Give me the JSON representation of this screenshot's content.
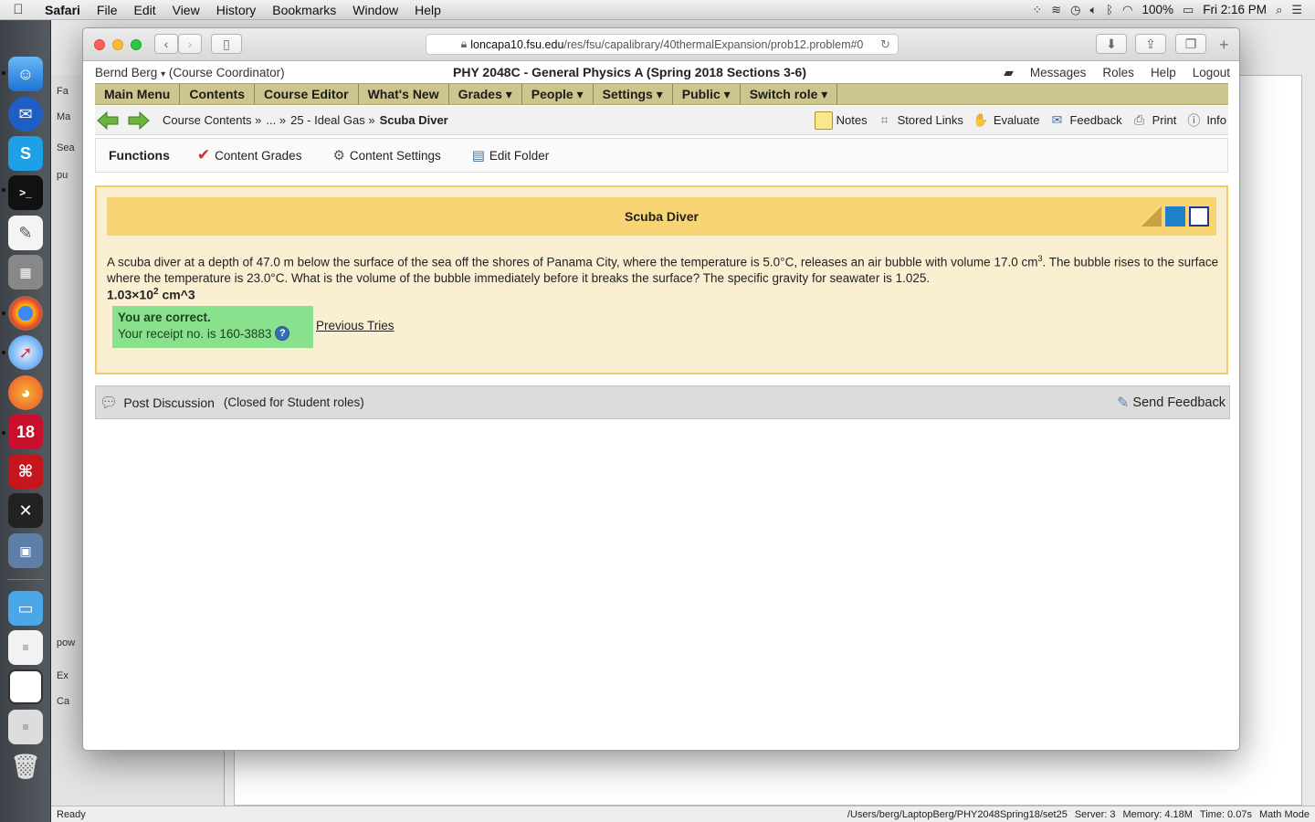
{
  "menubar": {
    "app": "Safari",
    "items": [
      "File",
      "Edit",
      "View",
      "History",
      "Bookmarks",
      "Window",
      "Help"
    ],
    "battery": "100%",
    "clock": "Fri 2:16 PM"
  },
  "dock": {
    "calendar_day": "18"
  },
  "browser": {
    "url_host": "loncapa10.fsu.edu",
    "url_path": "/res/fsu/capalibrary/40thermalExpansion/prob12.problem#0"
  },
  "lc": {
    "user": "Bernd Berg",
    "role": "(Course Coordinator)",
    "course": "PHY 2048C - General Physics A (Spring 2018 Sections 3-6)",
    "links": [
      "Messages",
      "Roles",
      "Help",
      "Logout"
    ],
    "nav": [
      "Main Menu",
      "Contents",
      "Course Editor",
      "What's New",
      "Grades ▾",
      "People ▾",
      "Settings ▾",
      "Public ▾",
      "Switch role ▾"
    ],
    "breadcrumb": [
      "Course Contents »",
      "... »",
      "25 - Ideal Gas »",
      "Scuba Diver"
    ],
    "tools": [
      "Notes",
      "Stored Links",
      "Evaluate",
      "Feedback",
      "Print",
      "Info"
    ],
    "functions_label": "Functions",
    "functions": [
      "Content Grades",
      "Content Settings",
      "Edit Folder"
    ]
  },
  "problem": {
    "title": "Scuba Diver",
    "text_1": "A scuba diver at a depth of 47.0 m below the surface of the sea off the shores of Panama City, where the temperature is 5.0°C, releases an air bubble with volume 17.0 cm",
    "text_sup": "3",
    "text_2": ". The bubble rises to the surface where the temperature is 23.0°C. What is the volume of the bubble immediately before it breaks the surface? The specific gravity for seawater is 1.025.",
    "answer_base": "1.03×10",
    "answer_exp": "2",
    "answer_unit": " cm^3",
    "status": "You are correct.",
    "receipt": "Your receipt no. is 160-3883",
    "previous_tries": "Previous Tries"
  },
  "discussion": {
    "post": "Post Discussion",
    "closed": "(Closed for Student roles)",
    "send": "Send Feedback"
  },
  "background_app": {
    "left_labels": [
      "Fa",
      "Ma",
      "Sea",
      "pu",
      "pow",
      "Ex",
      "Ca"
    ],
    "status_left": "Ready",
    "status_path": "/Users/berg/LaptopBerg/PHY2048Spring18/set25",
    "status_server": "Server: 3",
    "status_memory": "Memory: 4.18M",
    "status_time": "Time: 0.07s",
    "status_mode": "Math Mode"
  },
  "colors": {
    "nav_bg": "#cdc58e",
    "problem_bg": "#fbefd2",
    "title_bg": "#f9d474",
    "correct_bg": "#89e08d"
  }
}
